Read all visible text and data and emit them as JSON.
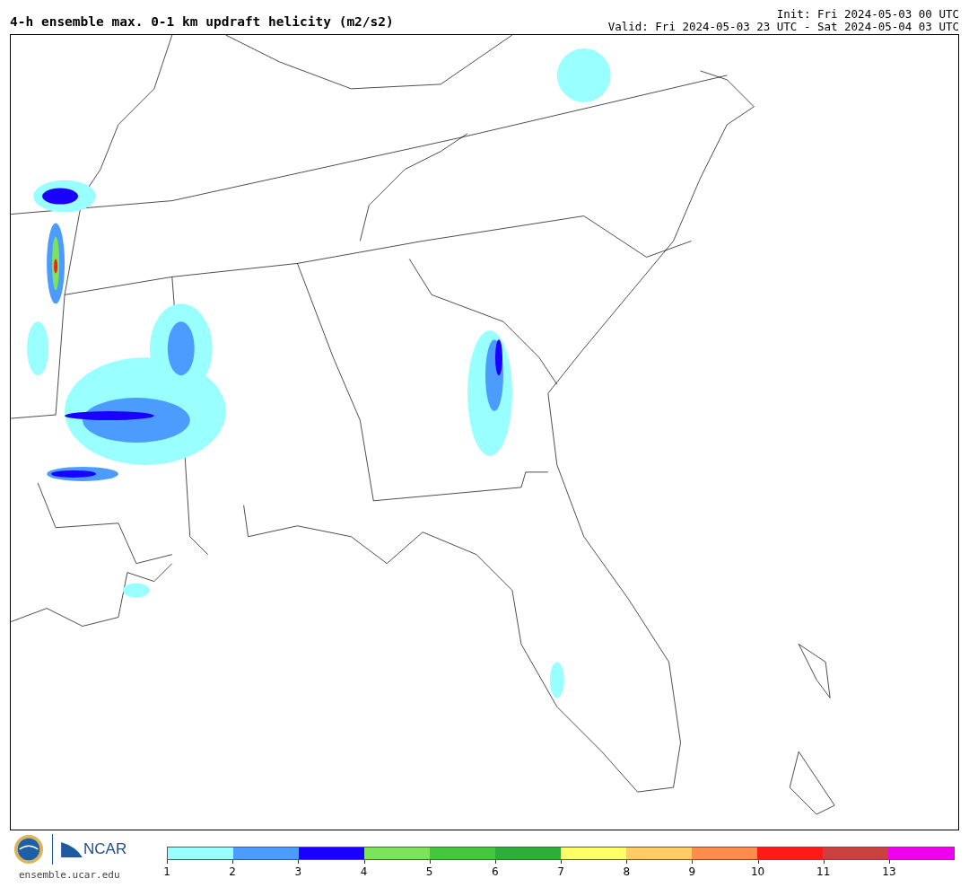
{
  "title": "4-h ensemble max. 0-1 km updraft helicity (m2/s2)",
  "init": "Init: Fri 2024-05-03 00 UTC",
  "valid": "Valid: Fri 2024-05-03 23 UTC - Sat 2024-05-04 03 UTC",
  "logo": {
    "text": "NCAR",
    "url": "ensemble.ucar.edu"
  },
  "colorbar": [
    {
      "label": "1",
      "color": "#99ffff"
    },
    {
      "label": "2",
      "color": "#4c9cff"
    },
    {
      "label": "3",
      "color": "#1a00ff"
    },
    {
      "label": "4",
      "color": "#7de35a"
    },
    {
      "label": "5",
      "color": "#44c63e"
    },
    {
      "label": "6",
      "color": "#2eae38"
    },
    {
      "label": "7",
      "color": "#ffff66"
    },
    {
      "label": "8",
      "color": "#ffcc66"
    },
    {
      "label": "9",
      "color": "#ff8c4c"
    },
    {
      "label": "10",
      "color": "#ff1a1a"
    },
    {
      "label": "11",
      "color": "#cc4040"
    },
    {
      "label": "13",
      "color": "#ee00ee"
    }
  ]
}
